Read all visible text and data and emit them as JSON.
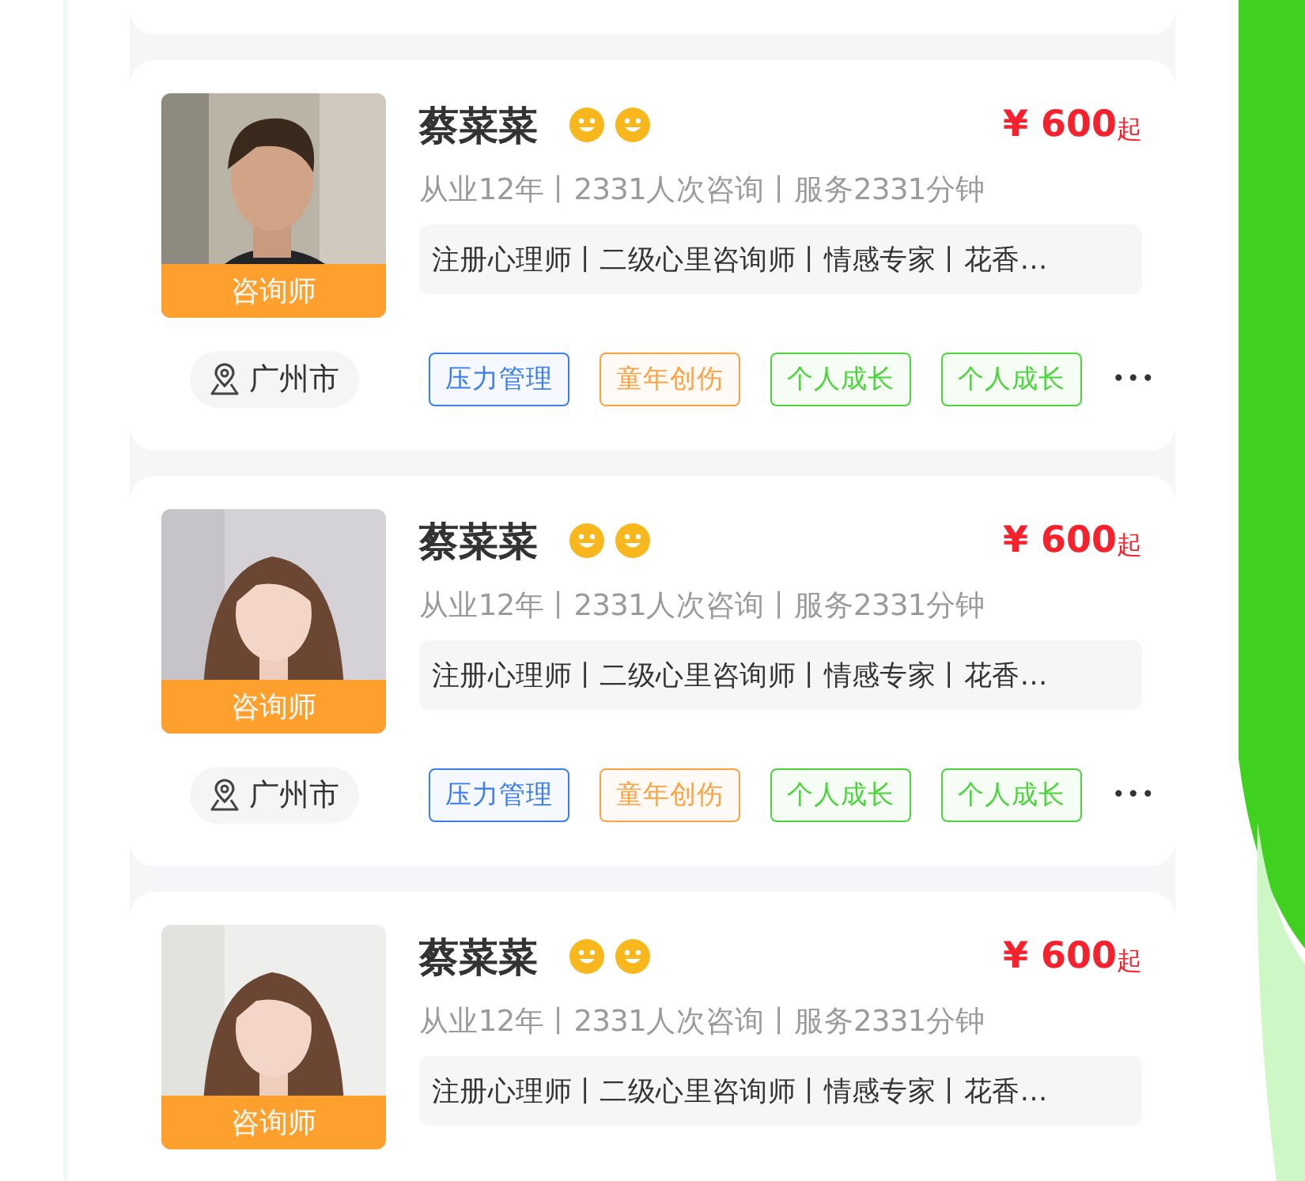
{
  "cards": [
    {
      "name": "蔡菜菜",
      "price": "¥ 600",
      "price_suffix": "起",
      "stats": "从业12年丨2331人次咨询丨服务2331分钟",
      "qualifications": "注册心理师丨二级心里咨询师丨情感专家丨花香…",
      "badge": "咨询师",
      "location": "广州市",
      "tags": [
        {
          "label": "压力管理",
          "color": "#3b7cf0"
        },
        {
          "label": "童年创伤",
          "color": "#ffa040"
        },
        {
          "label": "个人成长",
          "color": "#4cd43c"
        },
        {
          "label": "个人成长",
          "color": "#4cd43c"
        }
      ],
      "more": "•••"
    },
    {
      "name": "蔡菜菜",
      "price": "¥ 600",
      "price_suffix": "起",
      "stats": "从业12年丨2331人次咨询丨服务2331分钟",
      "qualifications": "注册心理师丨二级心里咨询师丨情感专家丨花香…",
      "badge": "咨询师",
      "location": "广州市",
      "tags": [
        {
          "label": "压力管理",
          "color": "#3b7cf0"
        },
        {
          "label": "童年创伤",
          "color": "#ffa040"
        },
        {
          "label": "个人成长",
          "color": "#4cd43c"
        },
        {
          "label": "个人成长",
          "color": "#4cd43c"
        }
      ],
      "more": "•••"
    },
    {
      "name": "蔡菜菜",
      "price": "¥ 600",
      "price_suffix": "起",
      "stats": "从业12年丨2331人次咨询丨服务2331分钟",
      "qualifications": "注册心理师丨二级心里咨询师丨情感专家丨花香…",
      "badge": "咨询师"
    }
  ]
}
